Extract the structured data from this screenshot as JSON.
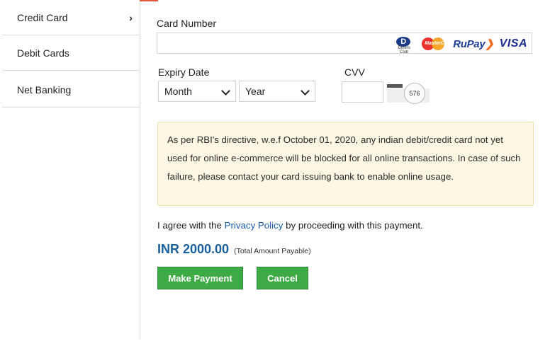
{
  "sidebar": {
    "items": [
      {
        "label": "Credit Card",
        "active": true
      },
      {
        "label": "Debit Cards"
      },
      {
        "label": "Net Banking"
      }
    ]
  },
  "form": {
    "card_number_label": "Card Number",
    "card_number_value": "",
    "brands": {
      "diners_label": "D",
      "diners_sub": "Diners Club",
      "mastercard_text": "MasterCard",
      "rupay": "RuPay",
      "visa": "VISA"
    },
    "expiry_label": "Expiry Date",
    "month_selected": "Month",
    "year_selected": "Year",
    "cvv_label": "CVV",
    "cvv_value": "",
    "cvv_hint_number": "576"
  },
  "notice": {
    "text": "As per RBI's directive, w.e.f October 01, 2020, any indian debit/credit card not yet used for online e-commerce will be blocked for all online transactions. In case of such failure, please contact your card issuing bank to enable online usage."
  },
  "agreement": {
    "prefix": "I agree with the ",
    "link": "Privacy Policy",
    "suffix": " by proceeding with this payment."
  },
  "amount": {
    "value": "INR 2000.00",
    "note": "(Total Amount Payable)"
  },
  "buttons": {
    "make_payment": "Make Payment",
    "cancel": "Cancel"
  },
  "colors": {
    "accent_blue": "#1a5f9e",
    "button_green": "#3eaa45",
    "notice_bg": "#fcf8e3",
    "top_accent": "#e4573b"
  }
}
